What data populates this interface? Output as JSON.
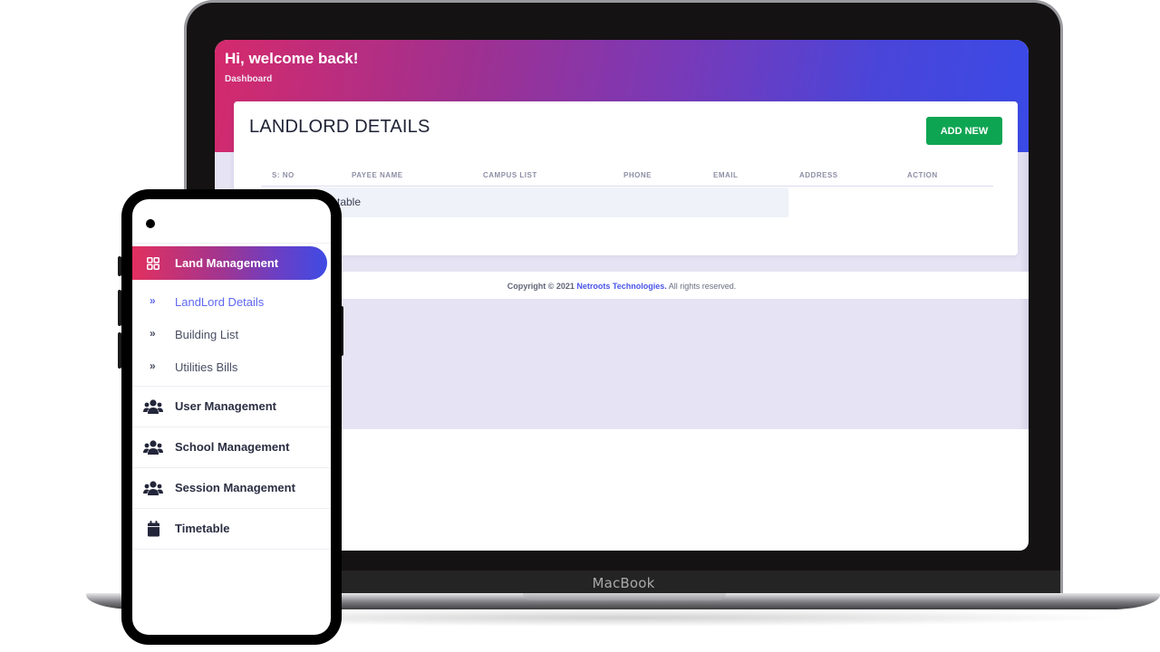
{
  "device": {
    "laptop_label": "MacBook"
  },
  "header": {
    "greeting": "Hi, welcome back!",
    "breadcrumb": "Dashboard"
  },
  "card": {
    "title": "LANDLORD DETAILS",
    "add_button_label": "ADD NEW",
    "table": {
      "columns": [
        "S: NO",
        "PAYEE NAME",
        "CAMPUS LIST",
        "PHONE",
        "EMAIL",
        "ADDRESS",
        "ACTION"
      ],
      "empty_row_text": "table"
    }
  },
  "footer": {
    "copyright": "Copyright © 2021",
    "brand": "Netroots Technologies.",
    "rights": "All rights reserved."
  },
  "sidebar": {
    "active_section": {
      "label": "Land Management",
      "icon": "grid-icon"
    },
    "sub_items": [
      {
        "label": "LandLord Details",
        "icon": "double-chevron-right-icon",
        "active": true
      },
      {
        "label": "Building List",
        "icon": "double-chevron-right-icon",
        "active": false
      },
      {
        "label": "Utilities Bills",
        "icon": "double-chevron-right-icon",
        "active": false
      }
    ],
    "items": [
      {
        "label": "User Management",
        "icon": "users-icon"
      },
      {
        "label": "School Management",
        "icon": "users-icon"
      },
      {
        "label": "Session Management",
        "icon": "users-icon"
      },
      {
        "label": "Timetable",
        "icon": "calendar-icon"
      }
    ]
  },
  "colors": {
    "accent_green": "#0ea552",
    "brand_link": "#4a55e8",
    "active_sub_item": "#5e68f0",
    "gradient_start": "#d52a6c",
    "gradient_end": "#3a4ae6",
    "page_band": "#e6e3f4"
  }
}
